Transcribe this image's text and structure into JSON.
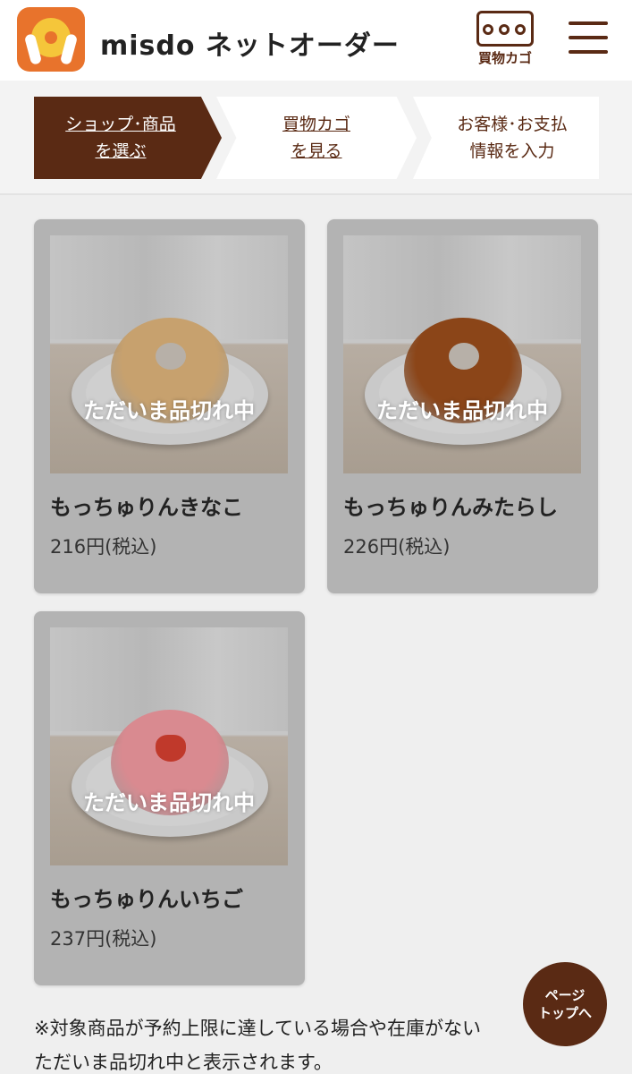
{
  "header": {
    "brand": "misdo ネットオーダー",
    "cart_label": "買物カゴ"
  },
  "steps": [
    {
      "line1": "ショップ･商品",
      "line2": "を選ぶ",
      "active": true
    },
    {
      "line1": "買物カゴ",
      "line2": "を見る",
      "active": false
    },
    {
      "line1": "お客様･お支払",
      "line2": "情報を入力",
      "active": false
    }
  ],
  "products": [
    {
      "name": "もっちゅりんきなこ",
      "price": "216円(税込)",
      "status": "ただいま品切れ中",
      "donut_color": "#c7a16e"
    },
    {
      "name": "もっちゅりんみたらし",
      "price": "226円(税込)",
      "status": "ただいま品切れ中",
      "donut_color": "#8b4518"
    },
    {
      "name": "もっちゅりんいちご",
      "price": "237円(税込)",
      "status": "ただいま品切れ中",
      "donut_color": "#d98a90"
    }
  ],
  "note": {
    "line1": "※対象商品が予約上限に達している場合や在庫がない",
    "line2": "ただいま品切れ中と表示されます。"
  },
  "page_top": {
    "line1": "ページ",
    "line2": "トップへ"
  },
  "colors": {
    "brand_brown": "#5a2a14",
    "logo_orange": "#e8732c",
    "card_gray": "#b3b3b3"
  }
}
